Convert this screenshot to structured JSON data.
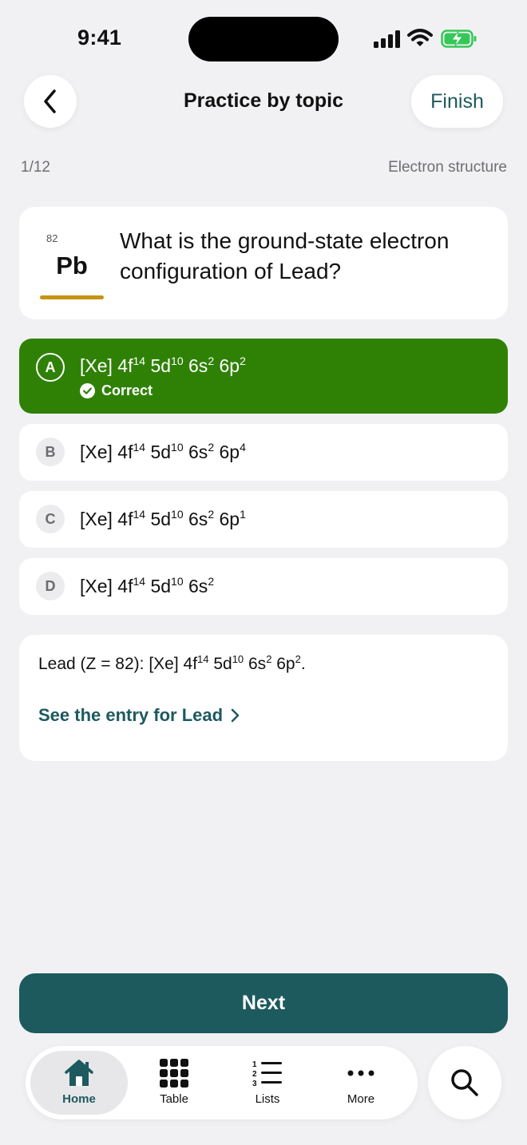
{
  "status_bar": {
    "time": "9:41"
  },
  "nav": {
    "title": "Practice by topic",
    "finish_label": "Finish"
  },
  "progress": {
    "text": "1/12",
    "topic": "Electron structure"
  },
  "question": {
    "element_number": "82",
    "element_symbol": "Pb",
    "text": "What is the ground-state electron configuration of Lead?"
  },
  "options": [
    {
      "letter": "A",
      "parts": [
        [
          "[Xe] 4f",
          "14"
        ],
        [
          " 5d",
          "10"
        ],
        [
          " 6s",
          "2"
        ],
        [
          " 6p",
          "2"
        ]
      ],
      "state": "correct",
      "feedback": "Correct"
    },
    {
      "letter": "B",
      "parts": [
        [
          "[Xe] 4f",
          "14"
        ],
        [
          " 5d",
          "10"
        ],
        [
          " 6s",
          "2"
        ],
        [
          " 6p",
          "4"
        ]
      ]
    },
    {
      "letter": "C",
      "parts": [
        [
          "[Xe] 4f",
          "14"
        ],
        [
          " 5d",
          "10"
        ],
        [
          " 6s",
          "2"
        ],
        [
          " 6p",
          "1"
        ]
      ]
    },
    {
      "letter": "D",
      "parts": [
        [
          "[Xe] 4f",
          "14"
        ],
        [
          " 5d",
          "10"
        ],
        [
          " 6s",
          "2"
        ]
      ]
    }
  ],
  "explanation": {
    "parts": [
      [
        "Lead (Z = 82): [Xe] 4f",
        "14"
      ],
      [
        " 5d",
        "10"
      ],
      [
        " 6s",
        "2"
      ],
      [
        " 6p",
        "2"
      ],
      [
        ".",
        ""
      ]
    ],
    "link_label": "See the entry for Lead"
  },
  "next_label": "Next",
  "tabs": [
    {
      "label": "Home",
      "icon": "home-icon",
      "active": true
    },
    {
      "label": "Table",
      "icon": "grid-icon"
    },
    {
      "label": "Lists",
      "icon": "list-icon"
    },
    {
      "label": "More",
      "icon": "more-icon"
    }
  ],
  "colors": {
    "accent": "#1c5a5e",
    "correct": "#2f8106",
    "element_category": "#c69411",
    "background": "#f1f1f4"
  }
}
